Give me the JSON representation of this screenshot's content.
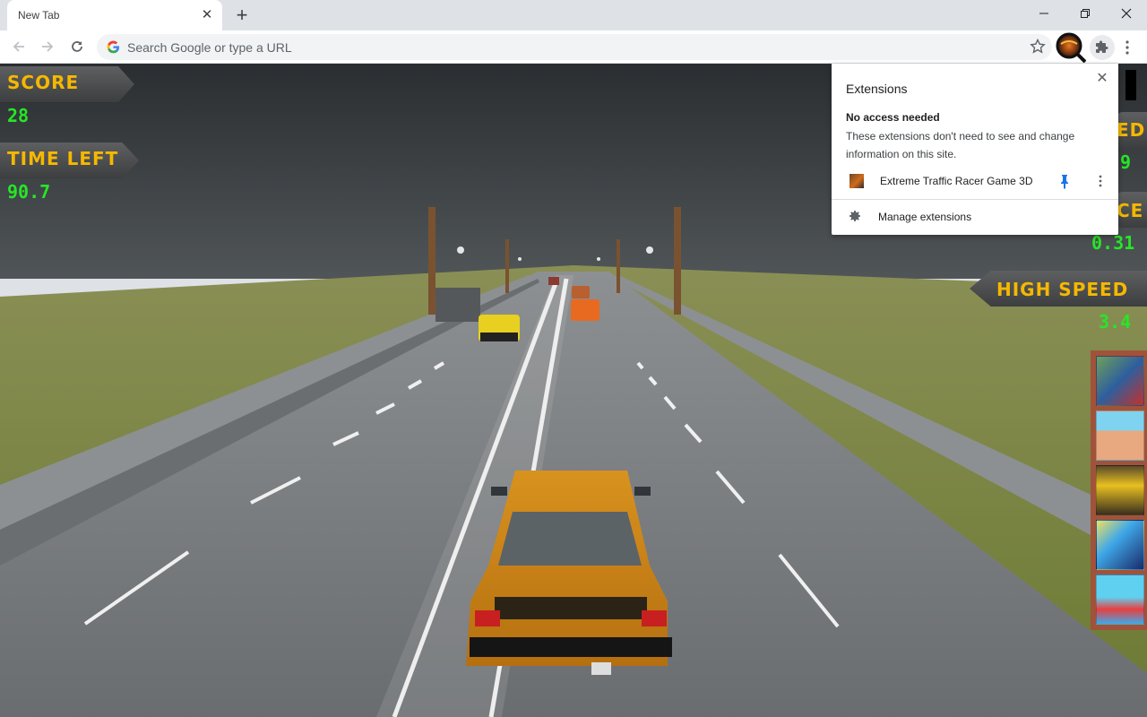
{
  "browser": {
    "tab_title": "New Tab",
    "tab_close_icon": "close-icon",
    "new_tab_icon": "plus-icon",
    "window_controls": [
      "minimize",
      "restore",
      "close"
    ],
    "omnibox_placeholder": "Search Google or type a URL",
    "colors": {
      "tabstrip": "#dee1e6",
      "toolbar": "#ffffff",
      "omnibox": "#f1f3f4"
    }
  },
  "extensions_popup": {
    "title": "Extensions",
    "section_title": "No access needed",
    "section_desc": "These extensions don't need to see and change information on this site.",
    "items": [
      {
        "name": "Extreme Traffic Racer Game 3D",
        "pinned": true
      }
    ],
    "manage_label": "Manage extensions",
    "pin_color": "#1a73e8"
  },
  "game": {
    "hud": {
      "score_label": "SCORE",
      "score_value": "28",
      "time_label": "TIME LEFT",
      "time_value": "90.7",
      "speed_label_partial": "ED",
      "speed_value_partial": "9",
      "distance_label_partial": "CE",
      "distance_value": "0.31",
      "high_speed_label": "HIGH SPEED",
      "high_speed_value": "3.4"
    },
    "colors": {
      "label": "#f5b800",
      "value": "#26e626",
      "plate": "#4a4b4c"
    },
    "more_games": [
      {
        "name": "traffic-racing-game",
        "palette": [
          "#2d5f9e",
          "#c4302b"
        ]
      },
      {
        "name": "thumb-wrestling-pirates",
        "palette": [
          "#7fd3f0",
          "#e8a880"
        ]
      },
      {
        "name": "shoot-up",
        "palette": [
          "#5a4a2a",
          "#e8c020"
        ]
      },
      {
        "name": "jetpack-shooter",
        "palette": [
          "#3fa8e8",
          "#1a2a6a"
        ]
      },
      {
        "name": "tug-the-table",
        "palette": [
          "#5fd0f0",
          "#e84040"
        ]
      }
    ]
  }
}
